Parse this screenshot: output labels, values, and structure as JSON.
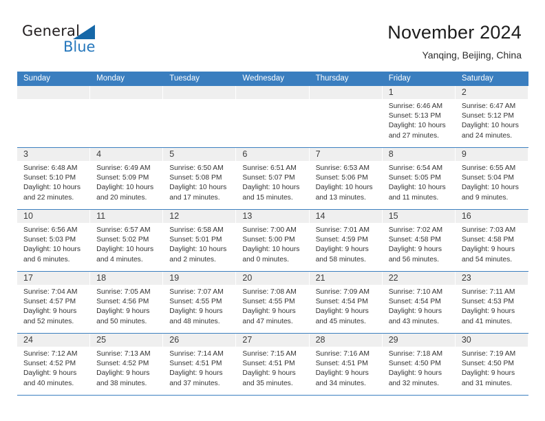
{
  "brand": {
    "name_part1": "General",
    "name_part2": "Blue",
    "triangle_icon": "blue-triangle-icon",
    "accent_color": "#2577bc"
  },
  "header": {
    "title": "November 2024",
    "subtitle": "Yanqing, Beijing, China"
  },
  "colors": {
    "header_blue": "#3a7ebf",
    "daybar_gray": "#efefef",
    "text": "#333333"
  },
  "weekdays": [
    "Sunday",
    "Monday",
    "Tuesday",
    "Wednesday",
    "Thursday",
    "Friday",
    "Saturday"
  ],
  "labels": {
    "sunrise": "Sunrise:",
    "sunset": "Sunset:",
    "daylight": "Daylight:"
  },
  "weeks": [
    [
      {
        "day": "",
        "empty": true
      },
      {
        "day": "",
        "empty": true
      },
      {
        "day": "",
        "empty": true
      },
      {
        "day": "",
        "empty": true
      },
      {
        "day": "",
        "empty": true
      },
      {
        "day": "1",
        "sunrise": "Sunrise: 6:46 AM",
        "sunset": "Sunset: 5:13 PM",
        "daylight1": "Daylight: 10 hours",
        "daylight2": "and 27 minutes."
      },
      {
        "day": "2",
        "sunrise": "Sunrise: 6:47 AM",
        "sunset": "Sunset: 5:12 PM",
        "daylight1": "Daylight: 10 hours",
        "daylight2": "and 24 minutes."
      }
    ],
    [
      {
        "day": "3",
        "sunrise": "Sunrise: 6:48 AM",
        "sunset": "Sunset: 5:10 PM",
        "daylight1": "Daylight: 10 hours",
        "daylight2": "and 22 minutes."
      },
      {
        "day": "4",
        "sunrise": "Sunrise: 6:49 AM",
        "sunset": "Sunset: 5:09 PM",
        "daylight1": "Daylight: 10 hours",
        "daylight2": "and 20 minutes."
      },
      {
        "day": "5",
        "sunrise": "Sunrise: 6:50 AM",
        "sunset": "Sunset: 5:08 PM",
        "daylight1": "Daylight: 10 hours",
        "daylight2": "and 17 minutes."
      },
      {
        "day": "6",
        "sunrise": "Sunrise: 6:51 AM",
        "sunset": "Sunset: 5:07 PM",
        "daylight1": "Daylight: 10 hours",
        "daylight2": "and 15 minutes."
      },
      {
        "day": "7",
        "sunrise": "Sunrise: 6:53 AM",
        "sunset": "Sunset: 5:06 PM",
        "daylight1": "Daylight: 10 hours",
        "daylight2": "and 13 minutes."
      },
      {
        "day": "8",
        "sunrise": "Sunrise: 6:54 AM",
        "sunset": "Sunset: 5:05 PM",
        "daylight1": "Daylight: 10 hours",
        "daylight2": "and 11 minutes."
      },
      {
        "day": "9",
        "sunrise": "Sunrise: 6:55 AM",
        "sunset": "Sunset: 5:04 PM",
        "daylight1": "Daylight: 10 hours",
        "daylight2": "and 9 minutes."
      }
    ],
    [
      {
        "day": "10",
        "sunrise": "Sunrise: 6:56 AM",
        "sunset": "Sunset: 5:03 PM",
        "daylight1": "Daylight: 10 hours",
        "daylight2": "and 6 minutes."
      },
      {
        "day": "11",
        "sunrise": "Sunrise: 6:57 AM",
        "sunset": "Sunset: 5:02 PM",
        "daylight1": "Daylight: 10 hours",
        "daylight2": "and 4 minutes."
      },
      {
        "day": "12",
        "sunrise": "Sunrise: 6:58 AM",
        "sunset": "Sunset: 5:01 PM",
        "daylight1": "Daylight: 10 hours",
        "daylight2": "and 2 minutes."
      },
      {
        "day": "13",
        "sunrise": "Sunrise: 7:00 AM",
        "sunset": "Sunset: 5:00 PM",
        "daylight1": "Daylight: 10 hours",
        "daylight2": "and 0 minutes."
      },
      {
        "day": "14",
        "sunrise": "Sunrise: 7:01 AM",
        "sunset": "Sunset: 4:59 PM",
        "daylight1": "Daylight: 9 hours",
        "daylight2": "and 58 minutes."
      },
      {
        "day": "15",
        "sunrise": "Sunrise: 7:02 AM",
        "sunset": "Sunset: 4:58 PM",
        "daylight1": "Daylight: 9 hours",
        "daylight2": "and 56 minutes."
      },
      {
        "day": "16",
        "sunrise": "Sunrise: 7:03 AM",
        "sunset": "Sunset: 4:58 PM",
        "daylight1": "Daylight: 9 hours",
        "daylight2": "and 54 minutes."
      }
    ],
    [
      {
        "day": "17",
        "sunrise": "Sunrise: 7:04 AM",
        "sunset": "Sunset: 4:57 PM",
        "daylight1": "Daylight: 9 hours",
        "daylight2": "and 52 minutes."
      },
      {
        "day": "18",
        "sunrise": "Sunrise: 7:05 AM",
        "sunset": "Sunset: 4:56 PM",
        "daylight1": "Daylight: 9 hours",
        "daylight2": "and 50 minutes."
      },
      {
        "day": "19",
        "sunrise": "Sunrise: 7:07 AM",
        "sunset": "Sunset: 4:55 PM",
        "daylight1": "Daylight: 9 hours",
        "daylight2": "and 48 minutes."
      },
      {
        "day": "20",
        "sunrise": "Sunrise: 7:08 AM",
        "sunset": "Sunset: 4:55 PM",
        "daylight1": "Daylight: 9 hours",
        "daylight2": "and 47 minutes."
      },
      {
        "day": "21",
        "sunrise": "Sunrise: 7:09 AM",
        "sunset": "Sunset: 4:54 PM",
        "daylight1": "Daylight: 9 hours",
        "daylight2": "and 45 minutes."
      },
      {
        "day": "22",
        "sunrise": "Sunrise: 7:10 AM",
        "sunset": "Sunset: 4:54 PM",
        "daylight1": "Daylight: 9 hours",
        "daylight2": "and 43 minutes."
      },
      {
        "day": "23",
        "sunrise": "Sunrise: 7:11 AM",
        "sunset": "Sunset: 4:53 PM",
        "daylight1": "Daylight: 9 hours",
        "daylight2": "and 41 minutes."
      }
    ],
    [
      {
        "day": "24",
        "sunrise": "Sunrise: 7:12 AM",
        "sunset": "Sunset: 4:52 PM",
        "daylight1": "Daylight: 9 hours",
        "daylight2": "and 40 minutes."
      },
      {
        "day": "25",
        "sunrise": "Sunrise: 7:13 AM",
        "sunset": "Sunset: 4:52 PM",
        "daylight1": "Daylight: 9 hours",
        "daylight2": "and 38 minutes."
      },
      {
        "day": "26",
        "sunrise": "Sunrise: 7:14 AM",
        "sunset": "Sunset: 4:51 PM",
        "daylight1": "Daylight: 9 hours",
        "daylight2": "and 37 minutes."
      },
      {
        "day": "27",
        "sunrise": "Sunrise: 7:15 AM",
        "sunset": "Sunset: 4:51 PM",
        "daylight1": "Daylight: 9 hours",
        "daylight2": "and 35 minutes."
      },
      {
        "day": "28",
        "sunrise": "Sunrise: 7:16 AM",
        "sunset": "Sunset: 4:51 PM",
        "daylight1": "Daylight: 9 hours",
        "daylight2": "and 34 minutes."
      },
      {
        "day": "29",
        "sunrise": "Sunrise: 7:18 AM",
        "sunset": "Sunset: 4:50 PM",
        "daylight1": "Daylight: 9 hours",
        "daylight2": "and 32 minutes."
      },
      {
        "day": "30",
        "sunrise": "Sunrise: 7:19 AM",
        "sunset": "Sunset: 4:50 PM",
        "daylight1": "Daylight: 9 hours",
        "daylight2": "and 31 minutes."
      }
    ]
  ]
}
